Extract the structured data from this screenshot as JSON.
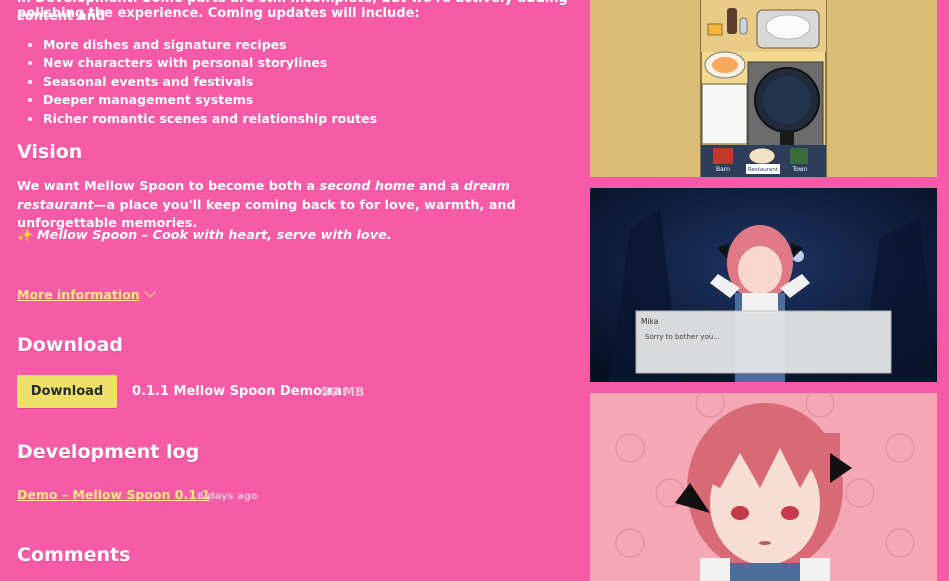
{
  "description": {
    "cut_line": "in Development. Some parts are still incomplete, but we're actively adding content and",
    "intro": "polishing the experience. Coming updates will include:",
    "updates": [
      "More dishes and signature recipes",
      "New characters with personal storylines",
      "Seasonal events and festivals",
      "Deeper management systems",
      "Richer romantic scenes and relationship routes"
    ],
    "vision_heading": "Vision",
    "vision_pre": "We want ",
    "vision_name": "Mellow Spoon",
    "vision_mid1": " to become both a ",
    "vision_em1": "second home",
    "vision_mid2": " and a ",
    "vision_em2": "dream restaurant",
    "vision_post": "—a place you'll keep coming back to for love, warmth, and unforgettable memories.",
    "tagline": "Mellow Spoon – Cook with heart, serve with love.",
    "more_info": "More information"
  },
  "download": {
    "heading": "Download",
    "button_label": "Download",
    "file_name": "0.1.1 Mellow Spoon Demo.rar",
    "file_size": "50 MB"
  },
  "devlog": {
    "heading": "Development log",
    "entry_title": "Demo – Mellow Spoon 0.1.1",
    "entry_date": "6 days ago"
  },
  "comments": {
    "heading": "Comments"
  },
  "screenshots": {
    "kitchen_labels": [
      "Barn",
      "Restaurant",
      "Town"
    ],
    "dialog_speaker": "Mika",
    "dialog_line": "Sorry to bother you..."
  },
  "colors": {
    "background": "#f75aa6",
    "link": "#ffe784",
    "button": "#ece06a"
  }
}
